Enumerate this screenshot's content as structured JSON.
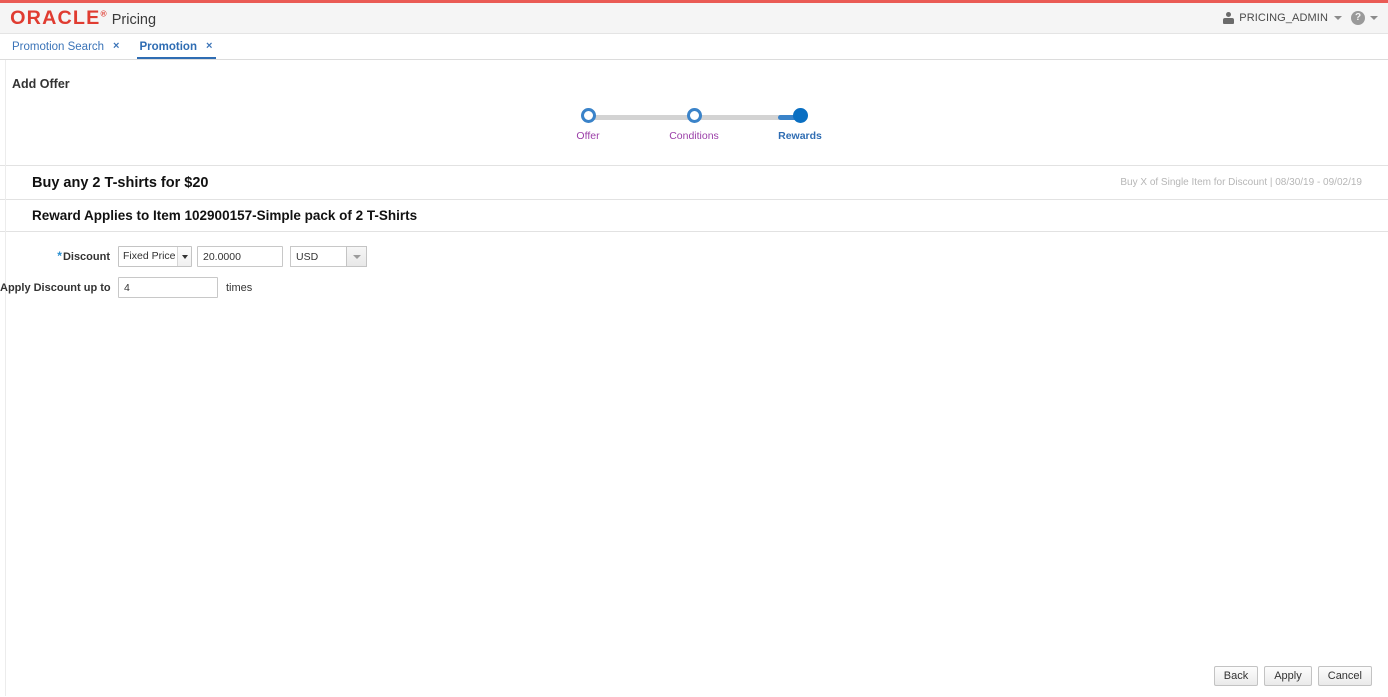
{
  "header": {
    "logo_text": "ORACLE",
    "logo_tm": "®",
    "app_name": "Pricing",
    "user_name": "PRICING_ADMIN",
    "help_glyph": "?"
  },
  "tabs": [
    {
      "label": "Promotion Search",
      "close": "×",
      "active": false
    },
    {
      "label": "Promotion",
      "close": "×",
      "active": true
    }
  ],
  "page": {
    "title": "Add Offer"
  },
  "train": {
    "stops": [
      {
        "label": "Offer",
        "state": "visited"
      },
      {
        "label": "Conditions",
        "state": "visited"
      },
      {
        "label": "Rewards",
        "state": "current"
      }
    ]
  },
  "offer": {
    "title": "Buy any 2 T-shirts for $20",
    "meta": "Buy X of Single Item for Discount  |  08/30/19  -  09/02/19",
    "reward_title": "Reward Applies to Item 102900157-Simple pack of 2 T-Shirts"
  },
  "form": {
    "discount_label": "Discount",
    "required_marker": "*",
    "discount_type_value": "Fixed Price",
    "discount_amount_value": "20.0000",
    "currency_value": "USD",
    "apply_label": "Apply Discount up to",
    "apply_times_value": "4",
    "times_suffix": "times"
  },
  "footer": {
    "back_label": "Back",
    "apply_label": "Apply",
    "cancel_label": "Cancel"
  },
  "colors": {
    "accent_red": "#ea5b55",
    "oracle_red": "#e03c31",
    "link_blue": "#3b74b8",
    "train_blue": "#0a6fc2",
    "train_visited_purple": "#9b3fa8",
    "required_blue": "#2a8fd0"
  }
}
